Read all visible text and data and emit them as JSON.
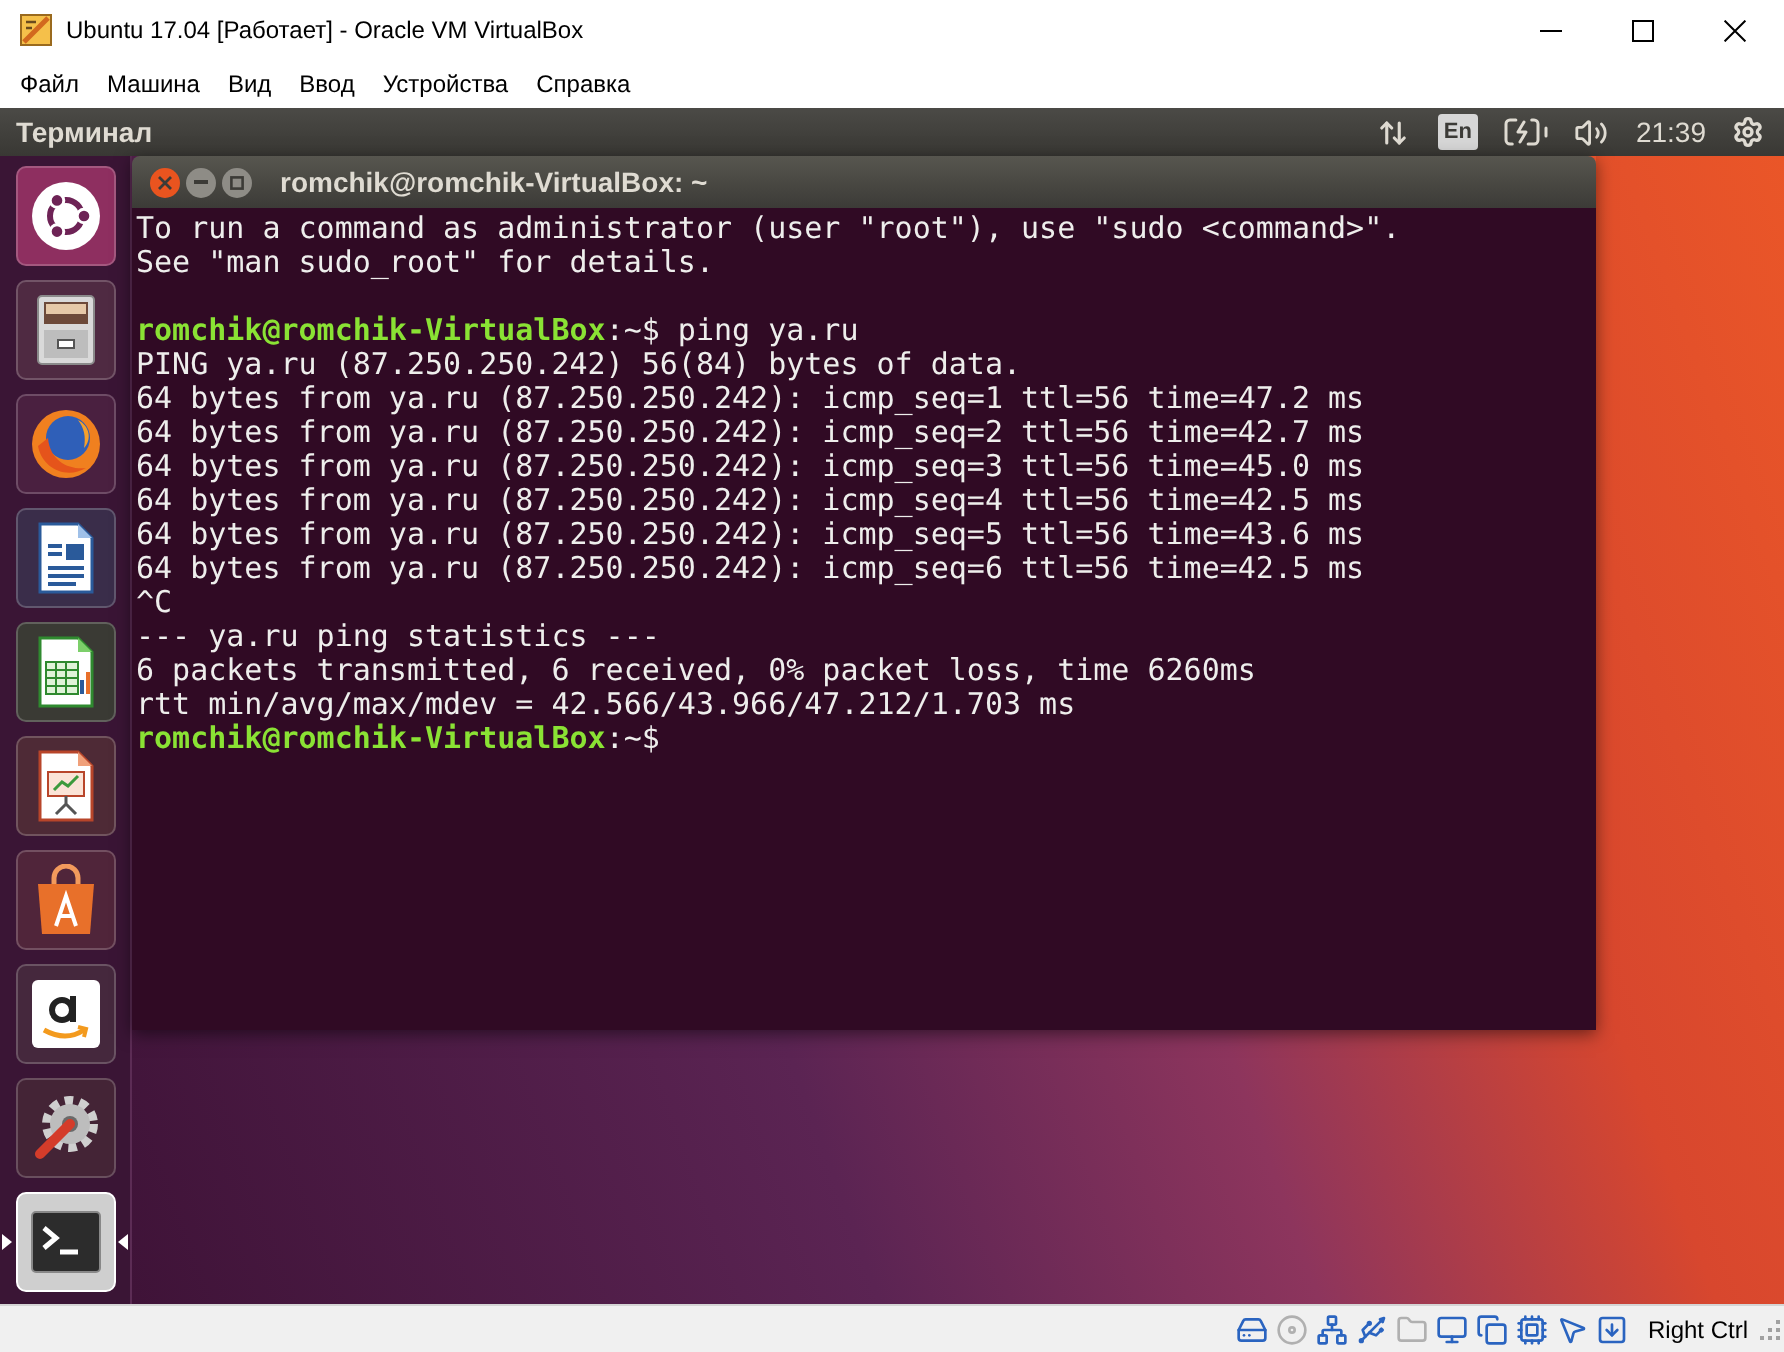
{
  "window": {
    "title": "Ubuntu 17.04 [Работает] - Oracle VM VirtualBox"
  },
  "menu": [
    {
      "label": "Файл"
    },
    {
      "label": "Машина"
    },
    {
      "label": "Вид"
    },
    {
      "label": "Ввод"
    },
    {
      "label": "Устройства"
    },
    {
      "label": "Справка"
    }
  ],
  "top_panel": {
    "app_title": "Терминал",
    "keyboard_layout": "En",
    "clock": "21:39"
  },
  "launcher": {
    "items": [
      {
        "kind": "dash",
        "selected": false
      },
      {
        "kind": "files",
        "selected": false
      },
      {
        "kind": "browser",
        "selected": false
      },
      {
        "kind": "document",
        "selected": false
      },
      {
        "kind": "spreadsheet",
        "selected": false
      },
      {
        "kind": "presentation",
        "selected": false
      },
      {
        "kind": "store",
        "selected": false
      },
      {
        "kind": "shopping",
        "selected": false
      },
      {
        "kind": "settings",
        "selected": false
      },
      {
        "kind": "terminal",
        "selected": true
      }
    ]
  },
  "terminal": {
    "title": "romchik@romchik-VirtualBox: ~",
    "lines": [
      {
        "kind": "output",
        "text": "To run a command as administrator (user \"root\"), use \"sudo <command>\"."
      },
      {
        "kind": "output",
        "text": "See \"man sudo_root\" for details."
      },
      {
        "kind": "blank"
      },
      {
        "kind": "prompt",
        "prompt": "romchik@romchik-VirtualBox",
        "text": ":~$ ping ya.ru"
      },
      {
        "kind": "output",
        "text": "PING ya.ru (87.250.250.242) 56(84) bytes of data."
      },
      {
        "kind": "output",
        "text": "64 bytes from ya.ru (87.250.250.242): icmp_seq=1 ttl=56 time=47.2 ms"
      },
      {
        "kind": "output",
        "text": "64 bytes from ya.ru (87.250.250.242): icmp_seq=2 ttl=56 time=42.7 ms"
      },
      {
        "kind": "output",
        "text": "64 bytes from ya.ru (87.250.250.242): icmp_seq=3 ttl=56 time=45.0 ms"
      },
      {
        "kind": "output",
        "text": "64 bytes from ya.ru (87.250.250.242): icmp_seq=4 ttl=56 time=42.5 ms"
      },
      {
        "kind": "output",
        "text": "64 bytes from ya.ru (87.250.250.242): icmp_seq=5 ttl=56 time=43.6 ms"
      },
      {
        "kind": "output",
        "text": "64 bytes from ya.ru (87.250.250.242): icmp_seq=6 ttl=56 time=42.5 ms"
      },
      {
        "kind": "output",
        "text": "^C"
      },
      {
        "kind": "output",
        "text": "--- ya.ru ping statistics ---"
      },
      {
        "kind": "output",
        "text": "6 packets transmitted, 6 received, 0% packet loss, time 6260ms"
      },
      {
        "kind": "output",
        "text": "rtt min/avg/max/mdev = 42.566/43.966/47.212/1.703 ms"
      },
      {
        "kind": "prompt",
        "prompt": "romchik@romchik-VirtualBox",
        "text": ":~$"
      }
    ]
  },
  "status_bar": {
    "devices": [
      {
        "kind": "hard_disk",
        "active": true
      },
      {
        "kind": "optical",
        "active": false
      },
      {
        "kind": "network",
        "active": true
      },
      {
        "kind": "usb",
        "active": true
      },
      {
        "kind": "shared_folder",
        "active": false
      },
      {
        "kind": "display",
        "active": true
      },
      {
        "kind": "capture",
        "active": true
      },
      {
        "kind": "cpu",
        "active": true
      },
      {
        "kind": "mouse",
        "active": true
      },
      {
        "kind": "keyboard",
        "active": true
      }
    ],
    "host_key": "Right Ctrl"
  }
}
